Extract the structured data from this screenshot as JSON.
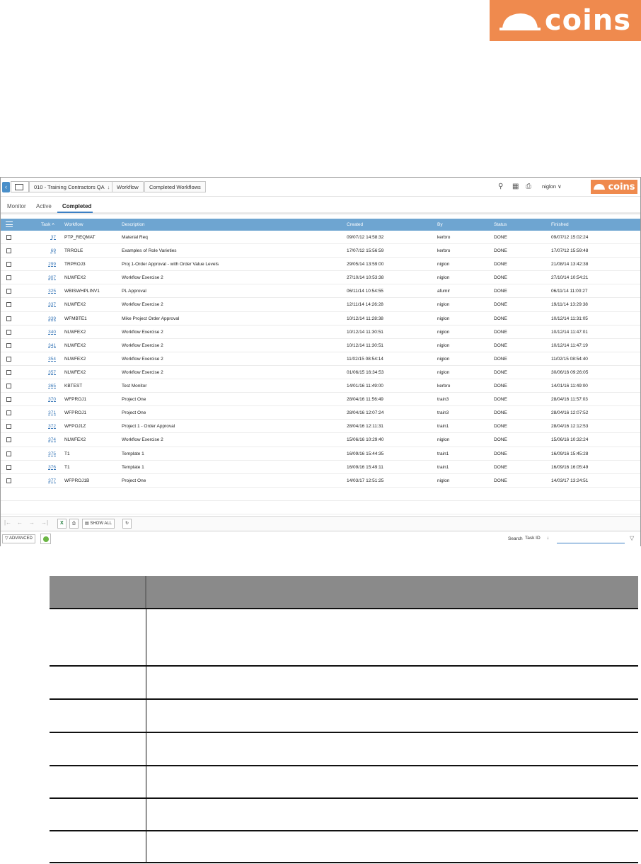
{
  "brand": {
    "name": "coins",
    "color": "#ef8a4e"
  },
  "breadcrumb": [
    "010 - Training Contractors QA",
    "Workflow",
    "Completed Workflows"
  ],
  "user": "niglon",
  "tabs": [
    {
      "label": "Monitor",
      "active": false
    },
    {
      "label": "Active",
      "active": false
    },
    {
      "label": "Completed",
      "active": true
    }
  ],
  "columns": {
    "task": "Task",
    "workflow": "Workflow",
    "description": "Description",
    "created": "Created",
    "by": "By",
    "status": "Status",
    "finished": "Finished"
  },
  "rows": [
    {
      "task": "37",
      "workflow": "PTP_REQMAT",
      "description": "Material Req",
      "created": "09/07/12 14:58:32",
      "by": "kerbro",
      "status": "DONE",
      "finished": "09/07/12 15:02:24"
    },
    {
      "task": "69",
      "workflow": "TRROLE",
      "description": "Examples of Role Varieties",
      "created": "17/07/12 15:56:59",
      "by": "kerbro",
      "status": "DONE",
      "finished": "17/07/12 15:59:48"
    },
    {
      "task": "299",
      "workflow": "TRPROJ3",
      "description": "Proj 1-Order Approval - with Order Value Levels",
      "created": "29/05/14 13:59:00",
      "by": "niglon",
      "status": "DONE",
      "finished": "21/08/14 13:42:38"
    },
    {
      "task": "307",
      "workflow": "NLWFEX2",
      "description": "Workflow Exercise 2",
      "created": "27/10/14 10:53:38",
      "by": "niglon",
      "status": "DONE",
      "finished": "27/10/14 10:54:21"
    },
    {
      "task": "325",
      "workflow": "WBISWHPLINV1",
      "description": "PL Approval",
      "created": "06/11/14 10:54:55",
      "by": "afumir",
      "status": "DONE",
      "finished": "06/11/14 11:00:27"
    },
    {
      "task": "337",
      "workflow": "NLWFEX2",
      "description": "Workflow Exercise 2",
      "created": "12/11/14 14:26:28",
      "by": "niglon",
      "status": "DONE",
      "finished": "19/11/14 13:29:38"
    },
    {
      "task": "339",
      "workflow": "WFMBTE1",
      "description": "Mike Project Order Approval",
      "created": "10/12/14 11:28:38",
      "by": "niglon",
      "status": "DONE",
      "finished": "10/12/14 11:31:05"
    },
    {
      "task": "340",
      "workflow": "NLWFEX2",
      "description": "Workflow Exercise 2",
      "created": "10/12/14 11:30:51",
      "by": "niglon",
      "status": "DONE",
      "finished": "10/12/14 11:47:01"
    },
    {
      "task": "341",
      "workflow": "NLWFEX2",
      "description": "Workflow Exercise 2",
      "created": "10/12/14 11:30:51",
      "by": "niglon",
      "status": "DONE",
      "finished": "10/12/14 11:47:19"
    },
    {
      "task": "354",
      "workflow": "NLWFEX2",
      "description": "Workflow Exercise 2",
      "created": "11/02/15 08:54:14",
      "by": "niglon",
      "status": "DONE",
      "finished": "11/02/15 08:54:40"
    },
    {
      "task": "357",
      "workflow": "NLWFEX2",
      "description": "Workflow Exercise 2",
      "created": "01/06/15 16:34:53",
      "by": "niglon",
      "status": "DONE",
      "finished": "30/06/16 09:26:05"
    },
    {
      "task": "365",
      "workflow": "KBTEST",
      "description": "Test Monitor",
      "created": "14/01/16 11:49:00",
      "by": "kerbro",
      "status": "DONE",
      "finished": "14/01/16 11:49:00"
    },
    {
      "task": "370",
      "workflow": "WFPROJ1",
      "description": "Project One",
      "created": "28/04/16 11:56:49",
      "by": "train3",
      "status": "DONE",
      "finished": "28/04/16 11:57:03"
    },
    {
      "task": "371",
      "workflow": "WFPROJ1",
      "description": "Project One",
      "created": "28/04/16 12:07:24",
      "by": "train3",
      "status": "DONE",
      "finished": "28/04/16 12:07:52"
    },
    {
      "task": "372",
      "workflow": "WFPOJ1Z",
      "description": "Project 1 - Order Approval",
      "created": "28/04/16 12:11:31",
      "by": "train1",
      "status": "DONE",
      "finished": "28/04/16 12:12:53"
    },
    {
      "task": "374",
      "workflow": "NLWFEX2",
      "description": "Workflow Exercise 2",
      "created": "15/06/16 10:29:40",
      "by": "niglon",
      "status": "DONE",
      "finished": "15/06/16 10:32:24"
    },
    {
      "task": "375",
      "workflow": "T1",
      "description": "Template 1",
      "created": "16/09/16 15:44:35",
      "by": "train1",
      "status": "DONE",
      "finished": "16/09/16 15:45:28"
    },
    {
      "task": "376",
      "workflow": "T1",
      "description": "Template 1",
      "created": "16/09/16 15:49:11",
      "by": "train1",
      "status": "DONE",
      "finished": "16/09/16 16:05:49"
    },
    {
      "task": "377",
      "workflow": "WFPROJ1B",
      "description": "Project One",
      "created": "14/03/17 12:51:25",
      "by": "niglon",
      "status": "DONE",
      "finished": "14/03/17 13:24:51"
    }
  ],
  "toolbar": {
    "show_all": "SHOW ALL",
    "excel": "X"
  },
  "statusbar": {
    "advanced": "ADVANCED",
    "search_label": "Search",
    "search_field": "Task ID",
    "search_value": ""
  }
}
